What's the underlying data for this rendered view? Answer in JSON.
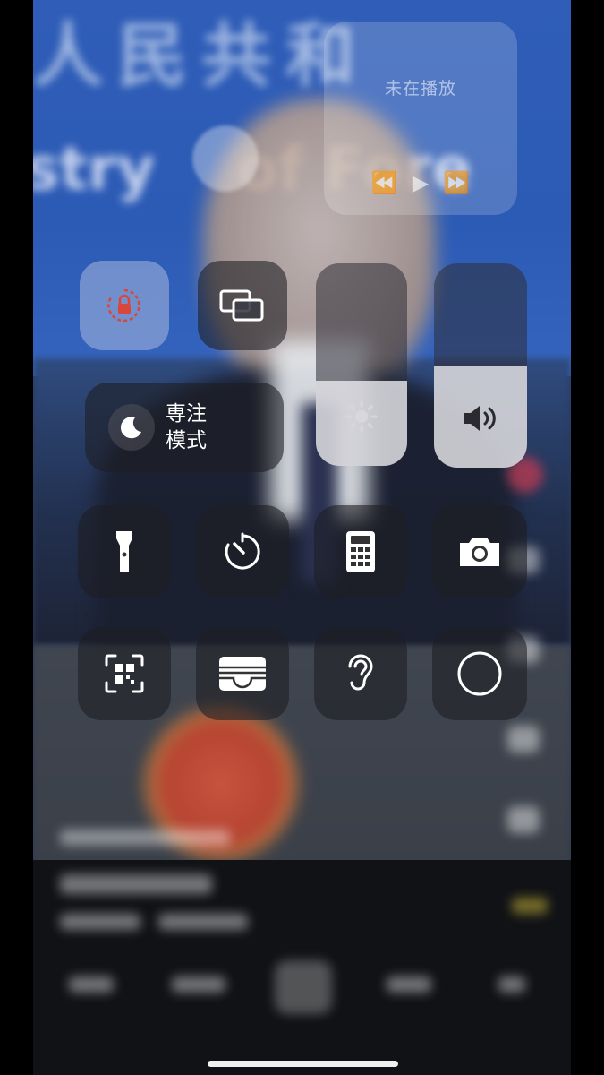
{
  "control_center": {
    "now_playing": {
      "title": "未在播放",
      "rewind_icon": "rewind-icon",
      "play_icon": "play-icon",
      "forward_icon": "fast-forward-icon"
    },
    "focus": {
      "label_line1": "専注",
      "label_line2": "模式",
      "icon": "moon-icon"
    },
    "brightness_level": 0.42,
    "volume_level": 0.5,
    "toggles": [
      {
        "name": "orientation-lock",
        "icon": "rotation-lock-icon",
        "active": true
      },
      {
        "name": "screen-mirroring",
        "icon": "screen-mirroring-icon",
        "active": false
      }
    ],
    "buttons": [
      {
        "name": "flashlight",
        "icon": "flashlight-icon"
      },
      {
        "name": "timer",
        "icon": "timer-icon"
      },
      {
        "name": "calculator",
        "icon": "calculator-icon"
      },
      {
        "name": "camera",
        "icon": "camera-icon"
      },
      {
        "name": "code-scanner",
        "icon": "qr-scanner-icon"
      },
      {
        "name": "wallet",
        "icon": "wallet-icon"
      },
      {
        "name": "hearing",
        "icon": "ear-icon"
      },
      {
        "name": "screen-recording",
        "icon": "record-icon"
      }
    ]
  },
  "colors": {
    "tile_bg": "#1e1e23",
    "accent_red": "#d9463b",
    "banner_blue": "#2c5bb5"
  }
}
